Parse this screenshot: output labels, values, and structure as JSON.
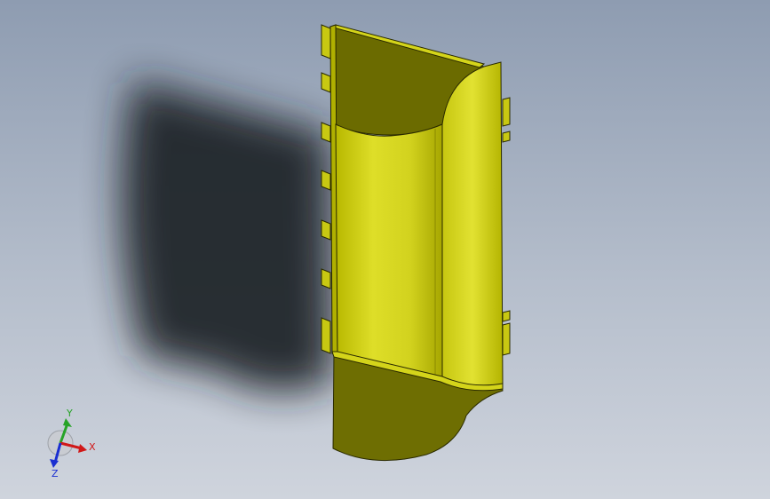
{
  "viewport": {
    "background_top": "#8e9cb1",
    "background_bottom": "#cfd4dd"
  },
  "model": {
    "body_color": "#d4d41a",
    "inner_color": "#6b6b00",
    "edge_color": "#2a2a00"
  },
  "triad": {
    "x_label": "X",
    "y_label": "Y",
    "z_label": "Z",
    "x_color": "#d11818",
    "y_color": "#27a327",
    "z_color": "#1a2fd1"
  }
}
